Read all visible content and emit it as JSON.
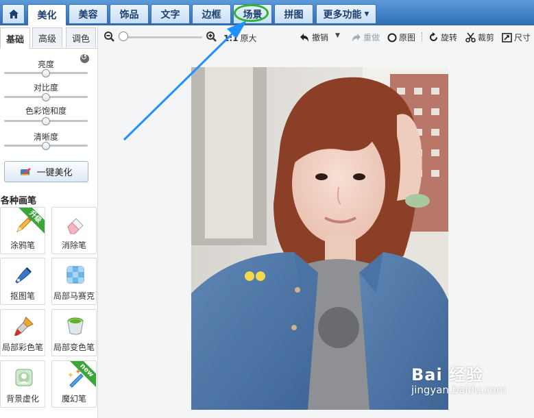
{
  "topnav": {
    "home_icon": "home-icon",
    "tabs": [
      "美化",
      "美容",
      "饰品",
      "文字",
      "边框",
      "场景",
      "拼图",
      "更多功能"
    ],
    "active": "美化",
    "highlighted": "场景"
  },
  "toolbar": {
    "zoom_label": "1:1",
    "original_size": "原大",
    "undo": "撤销",
    "redo": "重做",
    "original": "原图",
    "rotate": "旋转",
    "crop": "裁剪",
    "size": "尺寸"
  },
  "panel": {
    "subtabs": [
      "基础",
      "高级",
      "调色"
    ],
    "active_subtab": "基础",
    "sliders": [
      {
        "label": "亮度",
        "value": 0.5
      },
      {
        "label": "对比度",
        "value": 0.5
      },
      {
        "label": "色彩饱和度",
        "value": 0.5
      },
      {
        "label": "清晰度",
        "value": 0.5
      }
    ],
    "onekey_label": "一键美化",
    "brushes_title": "各种画笔",
    "brushes": [
      {
        "label": "涂鸦笔",
        "badge": "升级",
        "icon": "pencil-icon"
      },
      {
        "label": "消除笔",
        "badge": "",
        "icon": "eraser-icon"
      },
      {
        "label": "抠图笔",
        "badge": "",
        "icon": "pen-nib-icon"
      },
      {
        "label": "局部马赛克",
        "badge": "",
        "icon": "mosaic-icon"
      },
      {
        "label": "局部彩色笔",
        "badge": "",
        "icon": "paintbrush-icon"
      },
      {
        "label": "局部变色笔",
        "badge": "",
        "icon": "paint-bucket-icon"
      },
      {
        "label": "背景虚化",
        "badge": "",
        "icon": "blur-icon"
      },
      {
        "label": "魔幻笔",
        "badge": "new",
        "icon": "magic-wand-icon"
      }
    ]
  },
  "watermark": {
    "main": "Bai 经验",
    "sub": "jingyan.baidu.com"
  },
  "colors": {
    "topbar": "#3c7dc4",
    "annotation_arrow": "#1e90ff",
    "highlight_ring": "#2fb52f",
    "badge_green": "#3aa63a"
  }
}
